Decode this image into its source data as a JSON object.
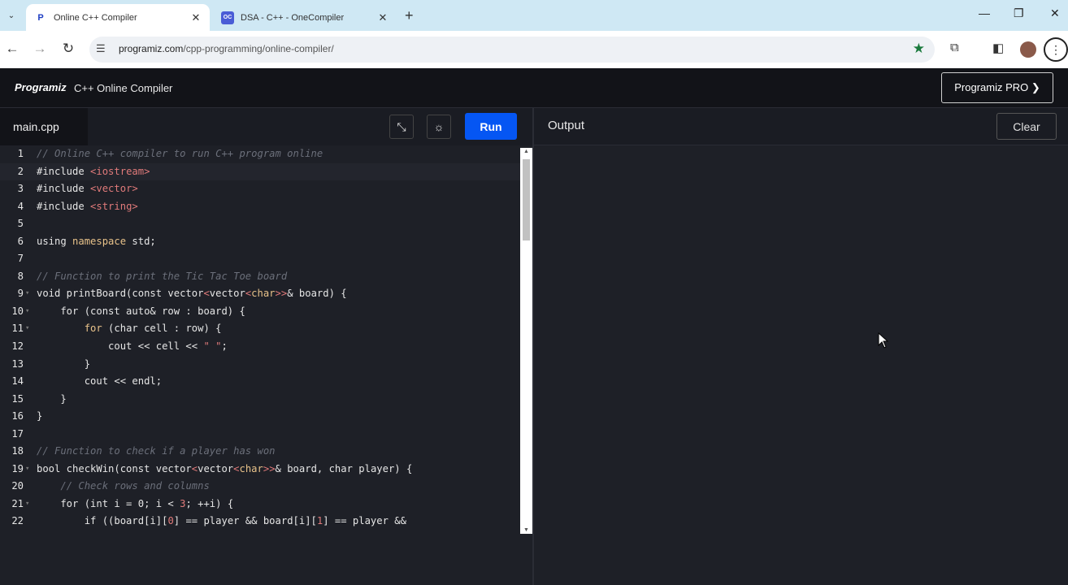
{
  "browser": {
    "tabs": [
      {
        "title": "Online C++ Compiler",
        "favicon": "programiz-icon",
        "active": true
      },
      {
        "title": "DSA - C++ - OneCompiler",
        "favicon": "onecompiler-icon",
        "active": false
      }
    ],
    "url_domain": "programiz.com",
    "url_path": "/cpp-programming/online-compiler/"
  },
  "app": {
    "logo": "Programiz",
    "title": "C++ Online Compiler",
    "pro_button": "Programiz PRO ❯"
  },
  "editor": {
    "filename": "main.cpp",
    "run_label": "Run",
    "current_line": 2,
    "lines": [
      {
        "n": "1",
        "fold": "",
        "html": "<span class='c'>// Online C++ compiler to run C++ program online</span>"
      },
      {
        "n": "2",
        "fold": "",
        "html": "#include <span class='s'>&lt;iostream&gt;</span>"
      },
      {
        "n": "3",
        "fold": "",
        "html": "#include <span class='s'>&lt;vector&gt;</span>"
      },
      {
        "n": "4",
        "fold": "",
        "html": "#include <span class='s'>&lt;string&gt;</span>"
      },
      {
        "n": "5",
        "fold": "",
        "html": ""
      },
      {
        "n": "6",
        "fold": "",
        "html": "using <span class='k'>namespace</span> std;"
      },
      {
        "n": "7",
        "fold": "",
        "html": ""
      },
      {
        "n": "8",
        "fold": "",
        "html": "<span class='c'>// Function to print the Tic Tac Toe board</span>"
      },
      {
        "n": "9",
        "fold": "▾",
        "html": "void printBoard(const vector<span class='s'>&lt;</span>vector<span class='s'>&lt;</span><span class='k'>char</span><span class='s'>&gt;&gt;</span>&amp; board) {"
      },
      {
        "n": "10",
        "fold": "▾",
        "html": "    for (const auto&amp; row : board) {"
      },
      {
        "n": "11",
        "fold": "▾",
        "html": "        <span class='k'>for</span> (char cell : row) {"
      },
      {
        "n": "12",
        "fold": "",
        "html": "            cout &lt;&lt; cell &lt;&lt; <span class='s'>\" \"</span>;"
      },
      {
        "n": "13",
        "fold": "",
        "html": "        }"
      },
      {
        "n": "14",
        "fold": "",
        "html": "        cout &lt;&lt; endl;"
      },
      {
        "n": "15",
        "fold": "",
        "html": "    }"
      },
      {
        "n": "16",
        "fold": "",
        "html": "}"
      },
      {
        "n": "17",
        "fold": "",
        "html": ""
      },
      {
        "n": "18",
        "fold": "",
        "html": "<span class='c'>// Function to check if a player has won</span>"
      },
      {
        "n": "19",
        "fold": "▾",
        "html": "bool checkWin(const vector<span class='s'>&lt;</span>vector<span class='s'>&lt;</span><span class='k'>char</span><span class='s'>&gt;&gt;</span>&amp; board, char player) {"
      },
      {
        "n": "20",
        "fold": "",
        "html": "    <span class='c'>// Check rows and columns</span>"
      },
      {
        "n": "21",
        "fold": "▾",
        "html": "    for (int i = 0; i &lt; <span class='s'>3</span>; ++i) {"
      },
      {
        "n": "22",
        "fold": "",
        "html": "        if ((board[i][<span class='s'>0</span>] == player &amp;&amp; board[i][<span class='s'>1</span>] == player &amp;&amp;"
      }
    ]
  },
  "output": {
    "title": "Output",
    "clear_label": "Clear"
  }
}
